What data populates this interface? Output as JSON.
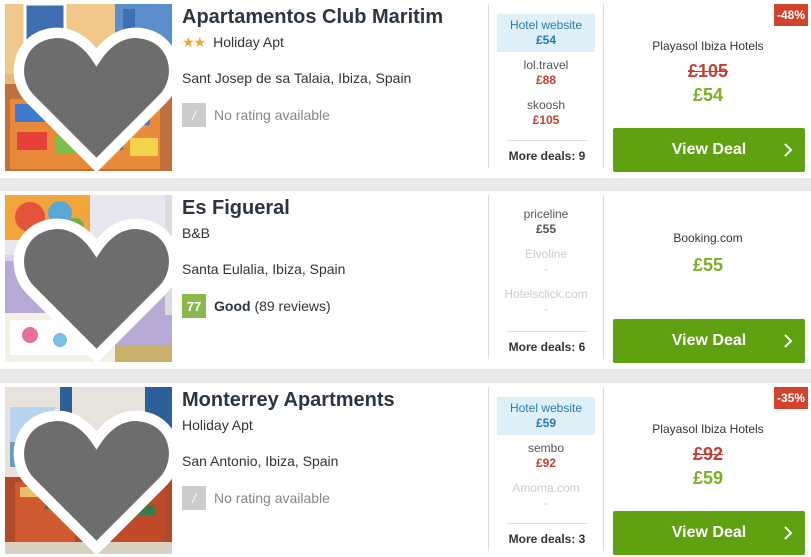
{
  "hotels": [
    {
      "name": "Apartamentos Club Maritim",
      "stars": "★★",
      "type": "Holiday Apt",
      "location": "Sant Josep de sa Talaia, Ibiza, Spain",
      "rating_score": "/",
      "rating_text": "No rating available",
      "deals": [
        {
          "name": "Hotel website",
          "price": "£54"
        },
        {
          "name": "lol.travel",
          "price": "£88"
        },
        {
          "name": "skoosh",
          "price": "£105"
        }
      ],
      "more_deals": "More deals: 9",
      "discount": "-48%",
      "provider": "Playasol Ibiza Hotels",
      "old_price": "£105",
      "price": "£54",
      "button": "View Deal"
    },
    {
      "name": "Es Figueral",
      "type": "B&B",
      "location": "Santa Eulalia, Ibiza, Spain",
      "rating_score": "77",
      "rating_label": "Good",
      "rating_reviews": "(89 reviews)",
      "deals": [
        {
          "name": "priceline",
          "price": "£55"
        },
        {
          "name": "Elvoline",
          "price": "-"
        },
        {
          "name": "Hotelsclick.com",
          "price": "-"
        }
      ],
      "more_deals": "More deals: 6",
      "provider": "Booking.com",
      "price": "£55",
      "button": "View Deal"
    },
    {
      "name": "Monterrey Apartments",
      "type": "Holiday Apt",
      "location": "San Antonio, Ibiza, Spain",
      "rating_score": "/",
      "rating_text": "No rating available",
      "deals": [
        {
          "name": "Hotel website",
          "price": "£59"
        },
        {
          "name": "sembo",
          "price": "£92"
        },
        {
          "name": "Amoma.com",
          "price": "-"
        }
      ],
      "more_deals": "More deals: 3",
      "discount": "-35%",
      "provider": "Playasol Ibiza Hotels",
      "old_price": "£92",
      "price": "£59",
      "button": "View Deal"
    }
  ],
  "icons": {
    "favorite": "heart-icon",
    "button_arrow": "chevron-right-icon"
  },
  "colors": {
    "view_deal": "#5fa111",
    "discount_badge": "#d0442e",
    "price_green": "#7ab022",
    "price_red": "#c34132",
    "highlight_deal": "#dff0f9",
    "rating_good": "#8ab84a"
  }
}
